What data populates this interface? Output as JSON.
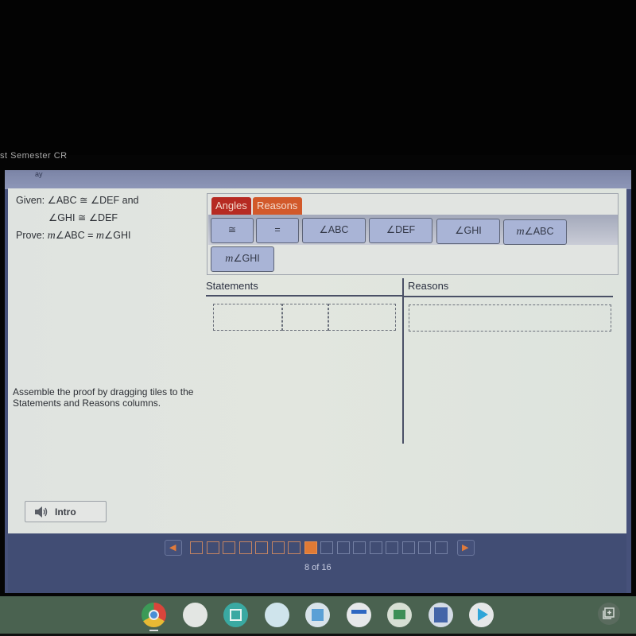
{
  "course": {
    "title": "st Semester CR"
  },
  "header": {
    "mark": "ay"
  },
  "problem": {
    "given_label": "Given:",
    "given_line1": "∠ABC ≅ ∠DEF and",
    "given_line2": "∠GHI ≅ ∠DEF",
    "prove_label": "Prove:",
    "prove_m1": "m",
    "prove_mid": "∠ABC = ",
    "prove_m2": "m",
    "prove_end": "∠GHI"
  },
  "instructions": "Assemble the proof by dragging tiles to the Statements and Reasons columns.",
  "tile_tabs": [
    {
      "label": "Angles",
      "color": "#b62a22",
      "active": true
    },
    {
      "label": "Reasons",
      "color": "#d2592a",
      "active": false
    }
  ],
  "tiles": [
    {
      "label": "≅"
    },
    {
      "label": "="
    },
    {
      "label": "∠ABC"
    },
    {
      "label": "∠DEF"
    },
    {
      "label": "∠GHI"
    },
    {
      "m": "m",
      "label": "∠ABC"
    },
    {
      "m": "m",
      "label": "∠GHI"
    }
  ],
  "columns": {
    "statements": "Statements",
    "reasons": "Reasons"
  },
  "intro_button": {
    "label": "Intro",
    "icon": "speaker-icon"
  },
  "pagination": {
    "total": 16,
    "current": 8,
    "counter_text": "8 of 16",
    "accent": "#e07a35",
    "prev_icon": "triangle-left-icon",
    "next_icon": "triangle-right-icon"
  },
  "shelf": {
    "apps": [
      "chrome-icon",
      "blank-app-icon",
      "calculator-app-icon",
      "science-app-icon",
      "brain-app-icon",
      "readworks-app-icon",
      "google-classroom-icon",
      "dance-app-icon",
      "play-store-icon"
    ],
    "right_icon": "overview-icon"
  }
}
